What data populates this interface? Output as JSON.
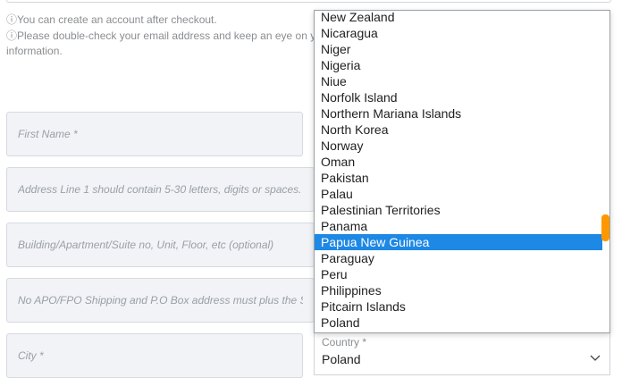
{
  "info": {
    "line1": "ⓘYou can create an account after checkout.",
    "line2": "ⓘPlease double-check your email address and keep an eye on yo",
    "line3": "information."
  },
  "form": {
    "first_name_placeholder": "First Name *",
    "address1_placeholder": "Address Line 1 should contain 5-30 letters, digits or spaces.",
    "address2_placeholder": "Building/Apartment/Suite no, Unit, Floor, etc (optional)",
    "address_note_placeholder": "No APO/FPO Shipping and P.O Box address must plus the Stre",
    "city_placeholder": "City *"
  },
  "country": {
    "label": "Country *",
    "value": "Poland",
    "options": [
      "New Zealand",
      "Nicaragua",
      "Niger",
      "Nigeria",
      "Niue",
      "Norfolk Island",
      "Northern Mariana Islands",
      "North Korea",
      "Norway",
      "Oman",
      "Pakistan",
      "Palau",
      "Palestinian Territories",
      "Panama",
      "Papua New Guinea",
      "Paraguay",
      "Peru",
      "Philippines",
      "Pitcairn Islands",
      "Poland"
    ],
    "highlighted_option": "Papua New Guinea"
  },
  "colors": {
    "highlight": "#1e88e5",
    "scrollbar_thumb": "#ff9800",
    "field_bg": "#f1f3f6"
  }
}
